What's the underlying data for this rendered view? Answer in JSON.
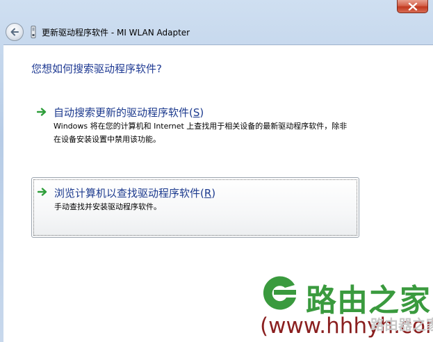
{
  "window": {
    "title": "更新驱动程序软件 - MI WLAN Adapter",
    "heading": "您想如何搜索驱动程序软件?"
  },
  "options": [
    {
      "title": "自动搜索更新的驱动程序软件(",
      "accelerator": "S",
      "title_end": ")",
      "description": "Windows 将在您的计算机和 Internet 上查找用于相关设备的最新驱动程序软件，除非在设备安装设置中禁用该功能。"
    },
    {
      "title": "浏览计算机以查找驱动程序软件(",
      "accelerator": "R",
      "title_end": ")",
      "description": "手动查找并安装驱动程序软件。"
    }
  ],
  "watermark": {
    "name": "路由之家",
    "url": "(www.hhhyh.com",
    "url_ghost": "路由器之家"
  },
  "colors": {
    "heading_blue": "#1f3a93",
    "arrow_green": "#2e9e3a",
    "close_red": "#c0391f",
    "watermark_green": "#3a9a3e",
    "watermark_red": "#8a1f1f"
  }
}
